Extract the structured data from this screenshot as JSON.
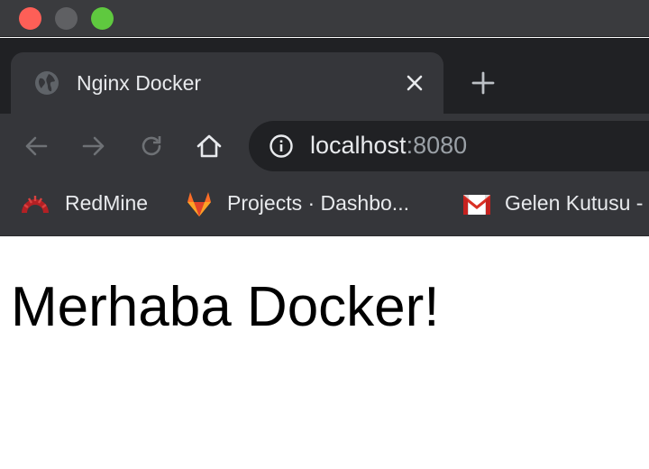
{
  "window": {
    "traffic_lights": [
      "close",
      "minimize",
      "zoom"
    ]
  },
  "tab": {
    "title": "Nginx Docker",
    "favicon": "globe-icon",
    "close_icon": "close-icon"
  },
  "new_tab_icon": "plus-icon",
  "toolbar": {
    "back_icon": "arrow-left-icon",
    "forward_icon": "arrow-right-icon",
    "reload_icon": "reload-icon",
    "home_icon": "home-icon",
    "info_icon": "info-icon",
    "url_host": "localhost",
    "url_port": ":8080"
  },
  "bookmarks": [
    {
      "label": "RedMine",
      "icon": "redmine-icon"
    },
    {
      "label": "Projects · Dashbo...",
      "icon": "gitlab-icon"
    },
    {
      "label": "Gelen Kutusu -",
      "icon": "gmail-icon"
    }
  ],
  "page": {
    "heading": "Merhaba Docker!"
  },
  "colors": {
    "titlebar": "#3a3b3e",
    "tabstrip": "#202124",
    "toolbar": "#35363a",
    "omnibox": "#202124",
    "text_light": "#e8eaed",
    "text_muted": "#9aa0a6"
  }
}
